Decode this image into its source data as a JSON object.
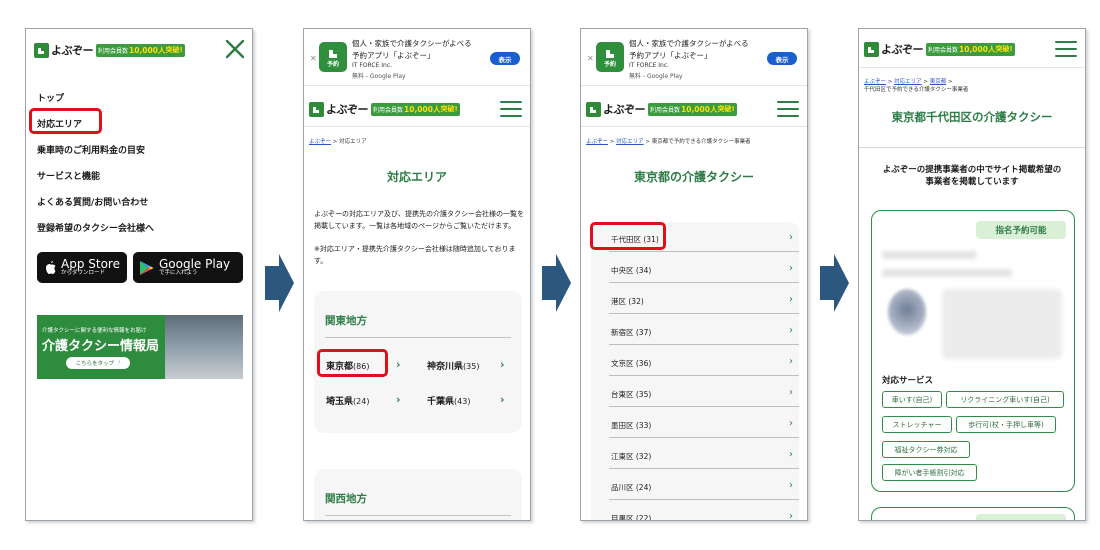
{
  "brand": {
    "name": "よぶぞー",
    "badge_label": "利用会員数",
    "badge_count": "10,000人",
    "badge_suffix": "突破!"
  },
  "colors": {
    "brand_green": "#2f7d46",
    "highlight_red": "#e0101a",
    "arrow_blue": "#2c5880",
    "link_blue": "#2a55c5"
  },
  "ad": {
    "line1": "個人・家族で介護タクシーがよべる",
    "line2": "予約アプリ「よぶぞー」",
    "publisher": "IT FORCE Inc.",
    "store": "無料 - Google Play",
    "button": "表示",
    "icon_label": "予約"
  },
  "screen1": {
    "menu": [
      "トップ",
      "対応エリア",
      "乗車時のご利用料金の目安",
      "サービスと機能",
      "よくある質問/お問い合わせ",
      "登録希望のタクシー会社様へ"
    ],
    "app_store": {
      "big": "App Store",
      "small": "からダウンロード"
    },
    "google_play": {
      "big": "Google Play",
      "small": "で手に入れよう"
    },
    "promo": {
      "line1": "介護タクシーに関する便利な情報をお届け",
      "line2": "介護タクシー情報局",
      "button": "こちらをタップ"
    }
  },
  "screen2": {
    "breadcrumb": {
      "home": "よぶぞー",
      "sep": ">",
      "current": "対応エリア"
    },
    "title": "対応エリア",
    "intro": "よぶぞーの対応エリア及び、提携先の介護タクシー会社様の一覧を掲載しています。一覧は各地域のページからご覧いただけます。",
    "note": "※対応エリア・提携先介護タクシー会社様は随時追加しております。",
    "kanto": {
      "title": "関東地方",
      "prefs": [
        {
          "name": "東京都",
          "count": "(86)"
        },
        {
          "name": "神奈川県",
          "count": "(35)"
        },
        {
          "name": "埼玉県",
          "count": "(24)"
        },
        {
          "name": "千葉県",
          "count": "(43)"
        }
      ]
    },
    "kansai": {
      "title": "関西地方"
    }
  },
  "screen3": {
    "breadcrumb": {
      "home": "よぶぞー",
      "mid": "対応エリア",
      "current": "東京都で予約できる介護タクシー事業者"
    },
    "title": "東京都の介護タクシー",
    "wards": [
      "千代田区 (31)",
      "中央区 (34)",
      "港区 (32)",
      "新宿区 (37)",
      "文京区 (36)",
      "台東区 (35)",
      "墨田区 (33)",
      "江東区 (32)",
      "品川区 (24)",
      "目黒区 (22)"
    ]
  },
  "screen4": {
    "breadcrumb": {
      "home": "よぶぞー",
      "mid": "対応エリア",
      "pref": "東京都",
      "current": "千代田区で予約できる介護タクシー事業者"
    },
    "title": "東京都千代田区の介護タクシー",
    "subtitle_line1": "よぶぞーの提携事業者の中でサイト掲載希望の",
    "subtitle_line2": "事業者を掲載しています",
    "badge": "指名予約可能",
    "services_title": "対応サービス",
    "tags": [
      "車いす(自己)",
      "リクライニング車いす(自己)",
      "ストレッチャー",
      "歩行可(杖・手押し車等)",
      "福祉タクシー券対応",
      "障がい者手帳割引対応"
    ]
  }
}
